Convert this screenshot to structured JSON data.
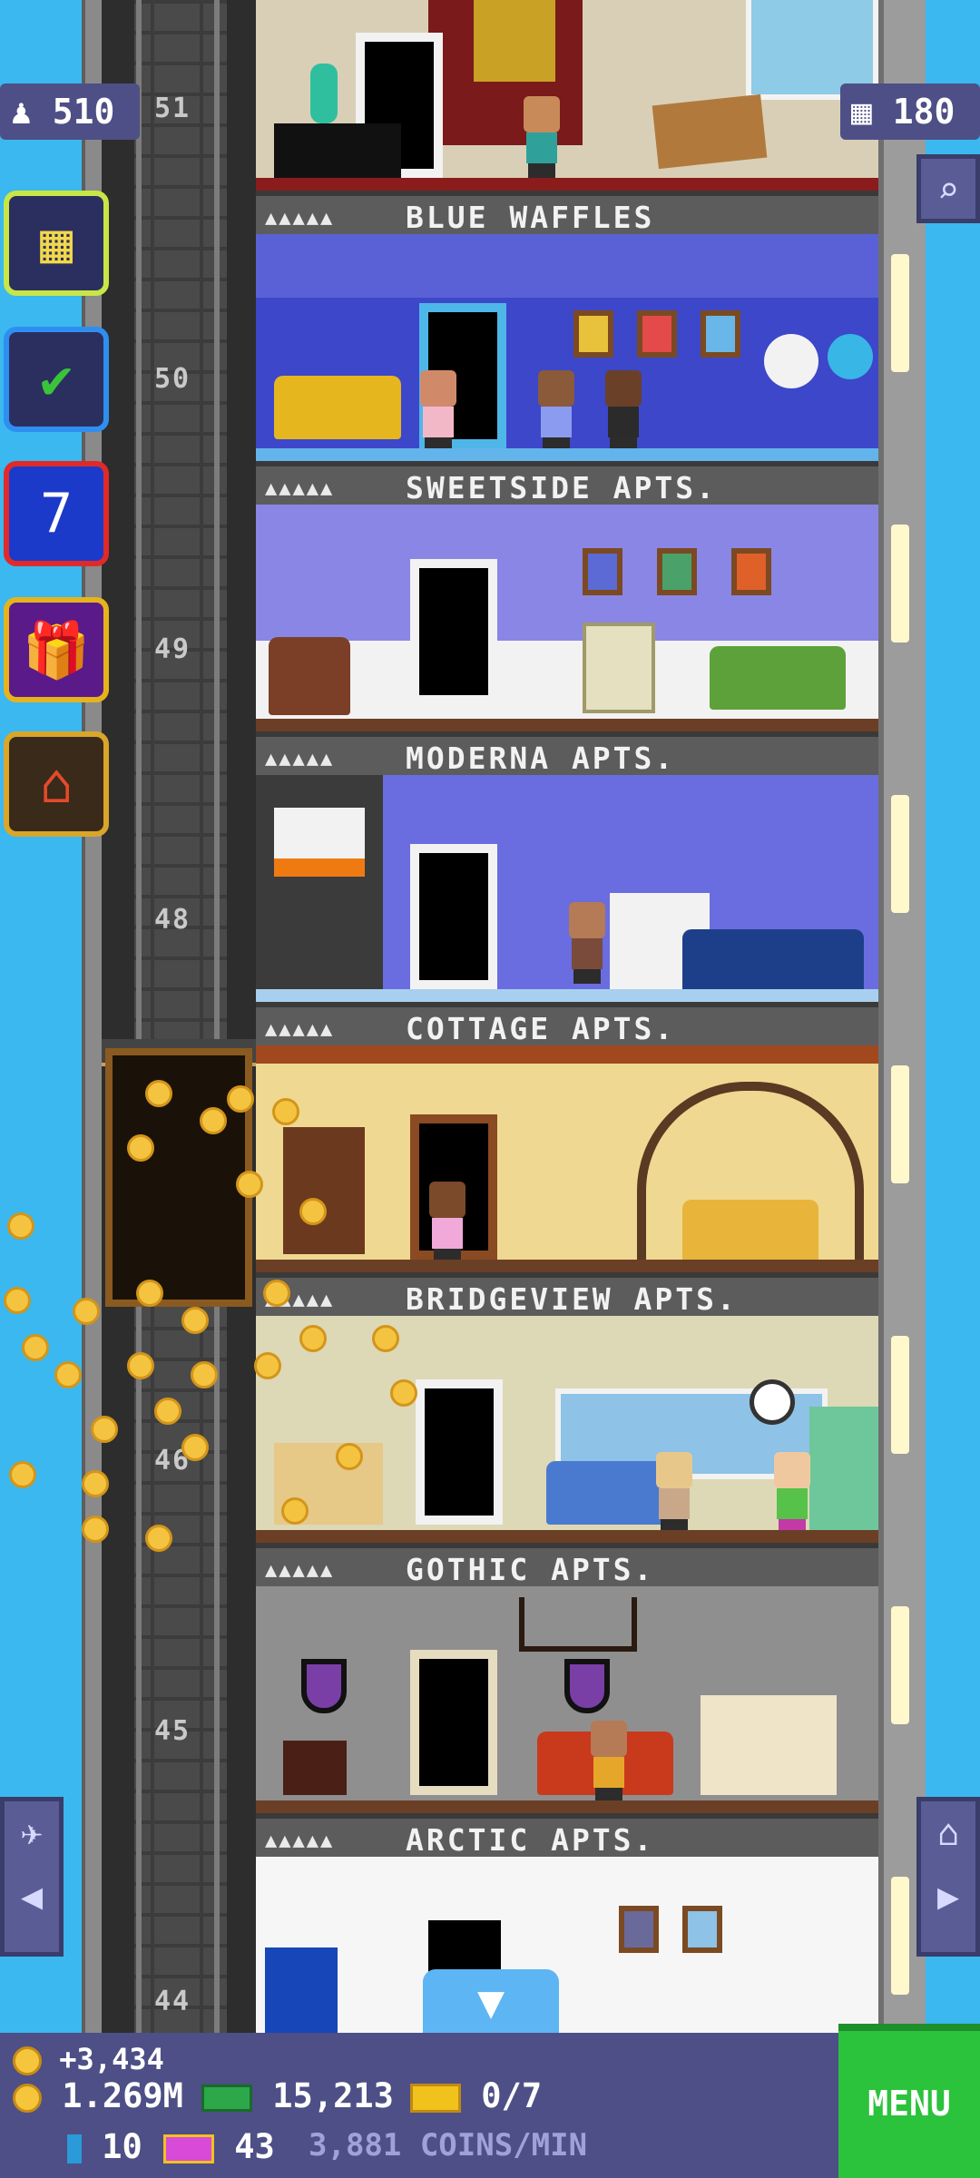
{
  "top_counters": {
    "population": "510",
    "floors": "180"
  },
  "side_buttons": [
    {
      "name": "building-button",
      "icon": "building-icon",
      "border": "#c8e646",
      "glyph": "▦"
    },
    {
      "name": "missions-button",
      "icon": "checklist-icon",
      "border": "#2f8ff0",
      "glyph": "✔"
    },
    {
      "name": "calendar-button",
      "icon": "calendar-icon",
      "border": "#e02a2a",
      "glyph": "7"
    },
    {
      "name": "gift-button",
      "icon": "gift-icon",
      "border": "#e6b31c",
      "glyph": "🎁"
    },
    {
      "name": "market-button",
      "icon": "market-stall-icon",
      "border": "#d9a62a",
      "glyph": "⌂"
    }
  ],
  "floor_numbers": [
    "51",
    "50",
    "49",
    "48",
    "46",
    "45",
    "44"
  ],
  "floors": [
    {
      "name": "BLUE WAFFLES",
      "stars": "▲▲▲▲▲",
      "wall": "#d9cfb7"
    },
    {
      "name": "SWEETSIDE APTS.",
      "stars": "▲▲▲▲▲",
      "wall": "#3d47c9"
    },
    {
      "name": "MODERNA APTS.",
      "stars": "▲▲▲▲▲",
      "wall": "#8a86e6"
    },
    {
      "name": "COTTAGE APTS.",
      "stars": "▲▲▲▲▲",
      "wall": "#6a6ddf"
    },
    {
      "name": "BRIDGEVIEW APTS.",
      "stars": "▲▲▲▲▲",
      "wall": "#efd891"
    },
    {
      "name": "GOTHIC APTS.",
      "stars": "▲▲▲▲▲",
      "wall": "#ddd8b6"
    },
    {
      "name": "ARCTIC APTS.",
      "stars": "▲▲▲▲▲",
      "wall": "#8f8f8f"
    }
  ],
  "bottom_bar": {
    "coins_delta": "+3,434",
    "coins_total": "1.269M",
    "bux": "15,213",
    "tickets": "0/7",
    "gems": "10",
    "vip": "43",
    "rate": "3,881 COINS/MIN",
    "menu_label": "MENU"
  },
  "nav": {
    "left_glyph": "◀",
    "right_glyph": "▶"
  },
  "colors": {
    "sky": "#3ab8ef",
    "panel": "#4d4f86",
    "menu_green": "#2bc23c",
    "coin": "#f4c440"
  }
}
